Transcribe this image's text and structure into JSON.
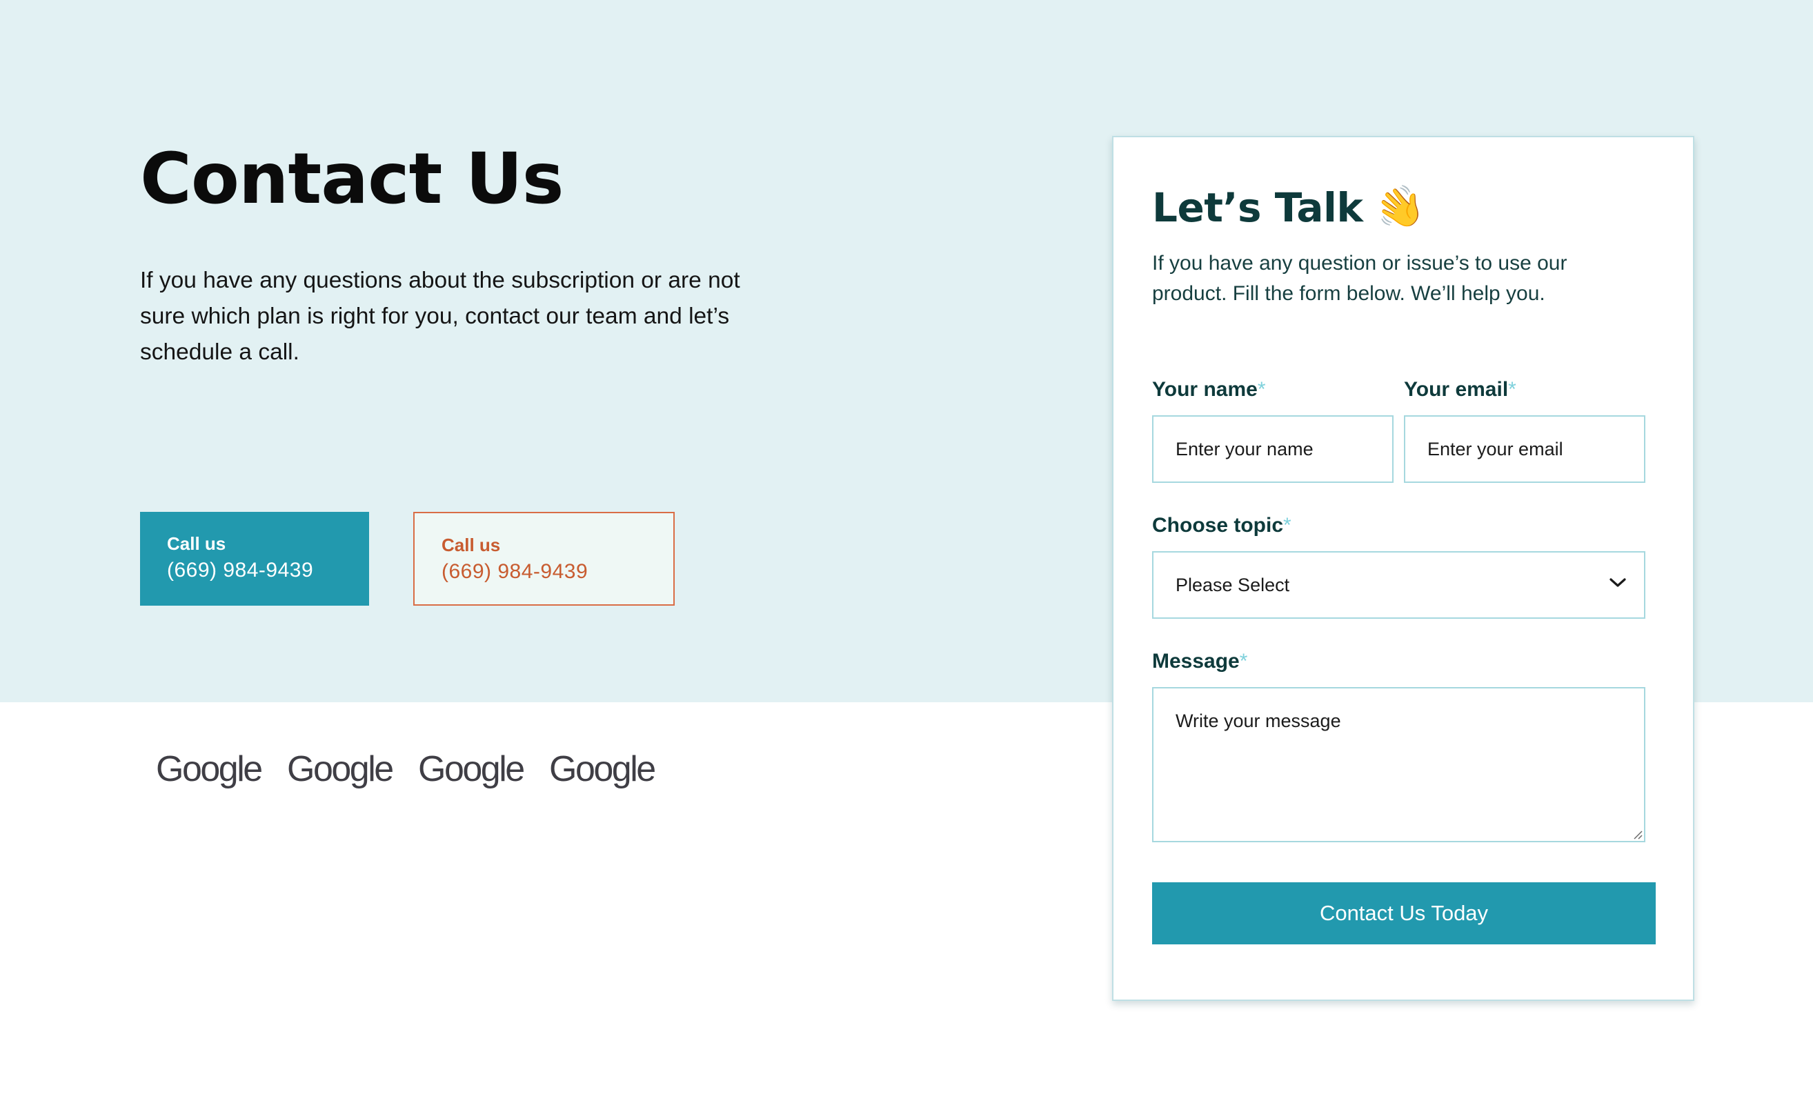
{
  "hero": {
    "title": "Contact Us",
    "description": "If you have any questions about the subscription or are not sure which plan is right for you, contact our team and let’s schedule a call."
  },
  "call_buttons": [
    {
      "label": "Call us",
      "phone": "(669) 984-9439"
    },
    {
      "label": "Call us",
      "phone": "(669) 984-9439"
    }
  ],
  "logos": [
    "Google",
    "Google",
    "Google",
    "Google"
  ],
  "form": {
    "title": "Let’s Talk",
    "title_emoji": "👋",
    "description": "If you have any question or issue’s to use our product. Fill the form below. We’ll help you.",
    "required_marker": "*",
    "name": {
      "label": "Your name",
      "placeholder": "Enter your name"
    },
    "email": {
      "label": "Your email",
      "placeholder": "Enter your email"
    },
    "topic": {
      "label": "Choose topic",
      "selected": "Please Select"
    },
    "message": {
      "label": "Message",
      "placeholder": "Write your message"
    },
    "submit_label": "Contact Us Today"
  },
  "colors": {
    "hero_background": "#e2f1f3",
    "primary": "#2299ae",
    "accent": "#d96d45",
    "required_marker": "#7ed1dc",
    "heading_text": "#0e3a3b"
  }
}
